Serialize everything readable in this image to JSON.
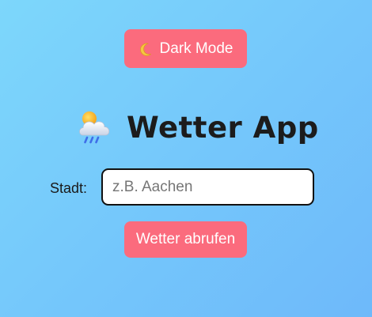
{
  "dark_mode_button": {
    "label": "Dark Mode",
    "icon": "crescent-moon-icon"
  },
  "header": {
    "title": "Wetter App",
    "icon": "sun-behind-rain-cloud-icon"
  },
  "city": {
    "label": "Stadt:",
    "placeholder": "z.B. Aachen",
    "value": ""
  },
  "fetch_button": {
    "label": "Wetter abrufen"
  },
  "colors": {
    "accent": "#fb6b7d",
    "background_start": "#7dd7fb",
    "background_end": "#6eb9fa",
    "title": "#1c1c1c"
  }
}
